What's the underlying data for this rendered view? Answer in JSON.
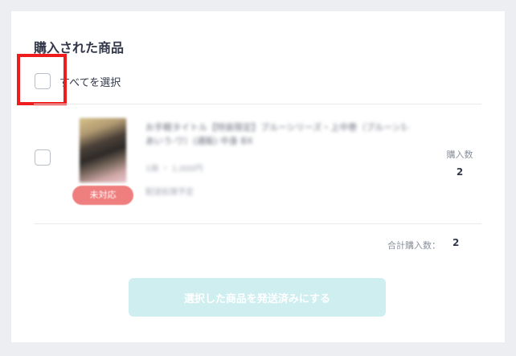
{
  "section": {
    "title": "購入された商品"
  },
  "select_all": {
    "label": "すべてを選択",
    "checked": false
  },
  "items": [
    {
      "name": "お手軽タイトル【特装限定】ブルーシリーズ・上中巻（ブルーン1-あいう-ワ）(通販) 中身 BX",
      "detail": "1冊 ・ 1,000円",
      "subdetail": "配送処理予定",
      "status_badge": "未対応",
      "quantity_label": "購入数",
      "quantity": "2",
      "checked": false
    }
  ],
  "summary": {
    "total_label": "合計購入数：",
    "total_value": "2"
  },
  "actions": {
    "ship_button_label": "選択した商品を発送済みにする",
    "ship_button_enabled": false
  },
  "colors": {
    "page_background": "#eceef2",
    "card_background": "#ffffff",
    "highlight": "#ee1c1c",
    "badge": "#ef7f7f",
    "button_disabled": "#cfeef0",
    "text_primary": "#33384a",
    "text_secondary": "#8a8f9b"
  }
}
